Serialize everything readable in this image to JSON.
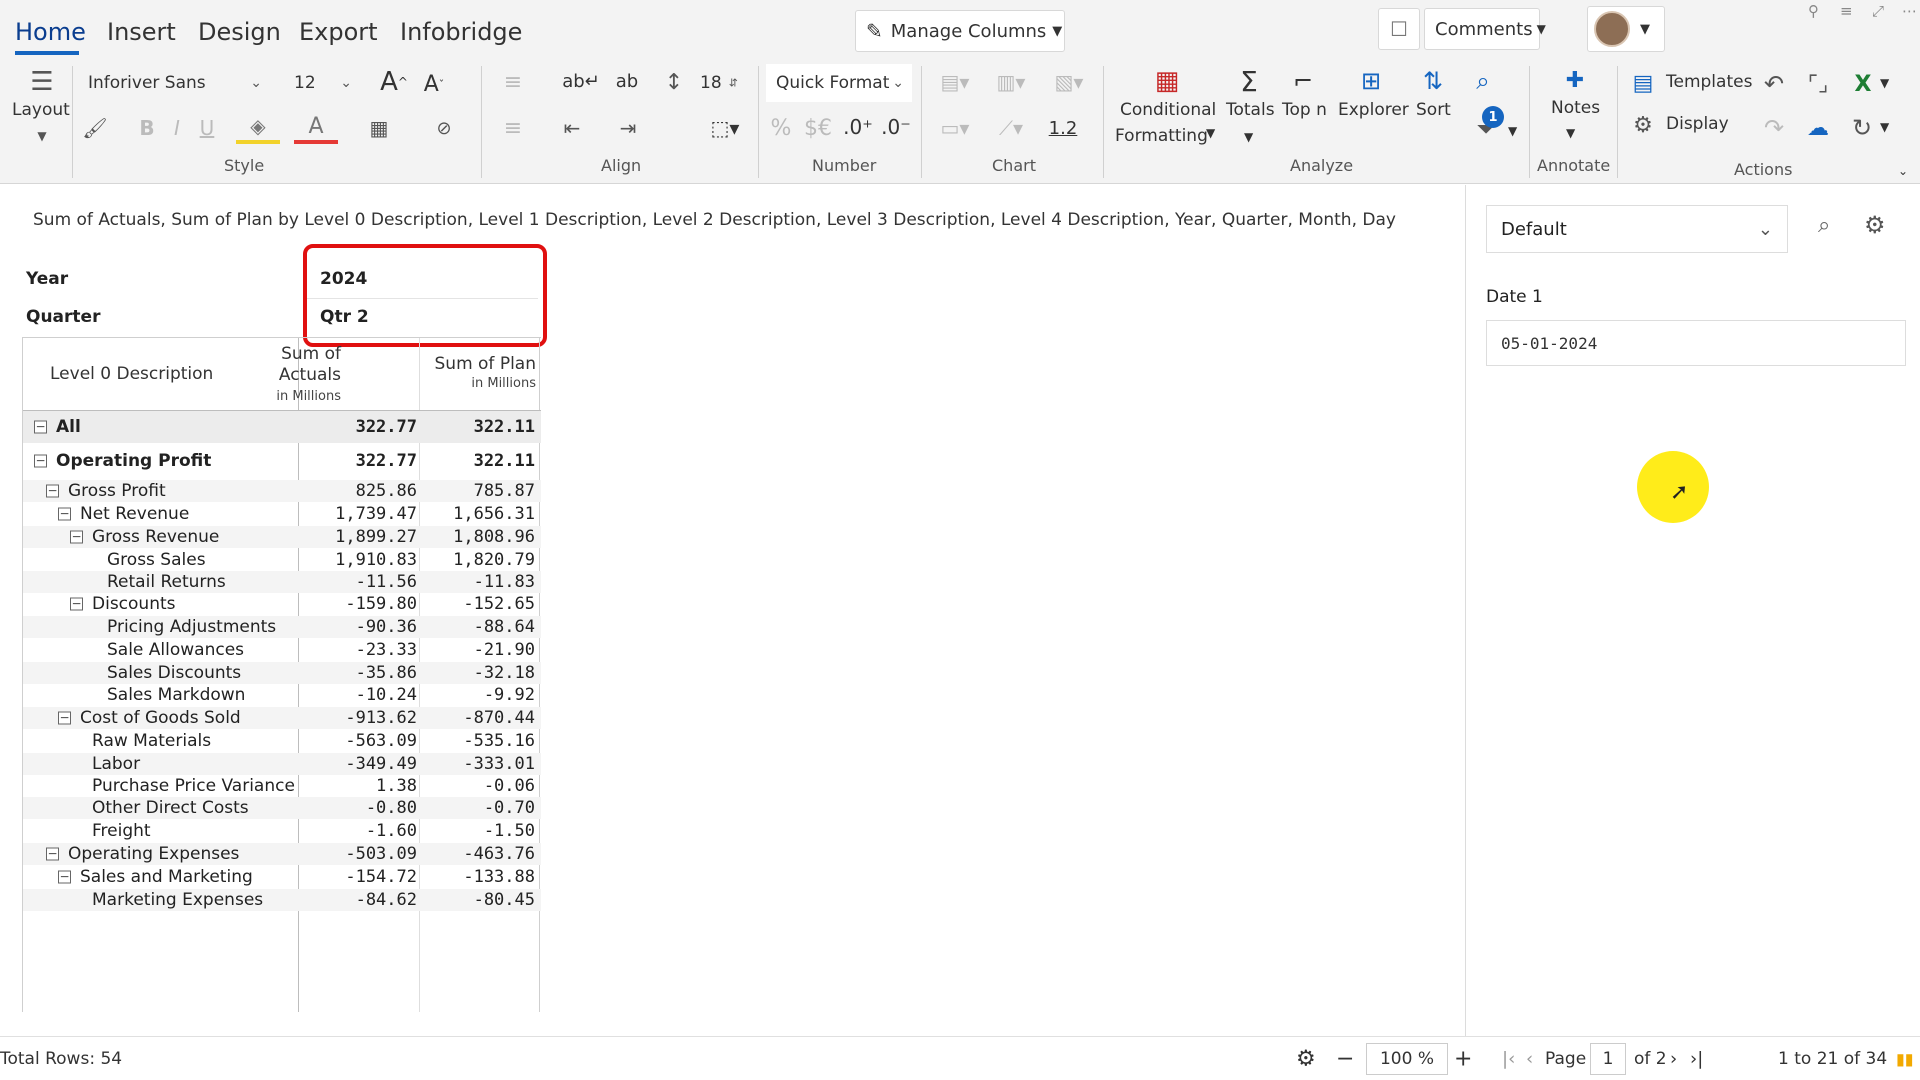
{
  "menu": {
    "tabs": [
      "Home",
      "Insert",
      "Design",
      "Export",
      "Infobridge"
    ]
  },
  "topbar": {
    "manage_columns": "Manage Columns",
    "comments": "Comments"
  },
  "ribbon": {
    "layout_label": "Layout",
    "font_family": "Inforiver Sans",
    "font_size": "12",
    "line_height": "18",
    "quick_format": "Quick Format",
    "decimal_value": "1.2",
    "conditional_line1": "Conditional",
    "conditional_line2": "Formatting",
    "totals": "Totals",
    "top_n": "Top n",
    "explorer": "Explorer",
    "sort": "Sort",
    "filter_badge": "1",
    "notes": "Notes",
    "templates": "Templates",
    "display": "Display",
    "groups": {
      "style": "Style",
      "align": "Align",
      "number": "Number",
      "chart": "Chart",
      "analyze": "Analyze",
      "annotate": "Annotate",
      "actions": "Actions"
    }
  },
  "report": {
    "title": "Sum of Actuals, Sum of Plan by Level 0 Description, Level 1 Description, Level 2 Description, Level 3 Description, Level 4 Description, Year, Quarter, Month, Day",
    "year_label": "Year",
    "year_value": "2024",
    "quarter_label": "Quarter",
    "quarter_value": "Qtr 2",
    "columns": {
      "label": "Level 0 Description",
      "actuals_line1": "Sum of",
      "actuals_line2": "Actuals",
      "plan": "Sum of Plan",
      "unit": "in Millions"
    },
    "rows": [
      {
        "label": "All",
        "actuals": "322.77",
        "plan": "322.11",
        "level": 0,
        "bold": true,
        "toggle": "⊟"
      },
      {
        "label": "Operating Profit",
        "actuals": "322.77",
        "plan": "322.11",
        "level": 0,
        "bold": true,
        "toggle": "⊟"
      },
      {
        "label": "Gross Profit",
        "actuals": "825.86",
        "plan": "785.87",
        "level": 1,
        "bold": false,
        "toggle": "⊟"
      },
      {
        "label": "Net Revenue",
        "actuals": "1,739.47",
        "plan": "1,656.31",
        "level": 2,
        "bold": false,
        "toggle": "⊟"
      },
      {
        "label": "Gross Revenue",
        "actuals": "1,899.27",
        "plan": "1,808.96",
        "level": 3,
        "bold": false,
        "toggle": "⊟"
      },
      {
        "label": "Gross Sales",
        "actuals": "1,910.83",
        "plan": "1,820.79",
        "level": 4,
        "bold": false,
        "toggle": ""
      },
      {
        "label": "Retail Returns",
        "actuals": "-11.56",
        "plan": "-11.83",
        "level": 4,
        "bold": false,
        "toggle": ""
      },
      {
        "label": "Discounts",
        "actuals": "-159.80",
        "plan": "-152.65",
        "level": 3,
        "bold": false,
        "toggle": "⊟"
      },
      {
        "label": "Pricing Adjustments",
        "actuals": "-90.36",
        "plan": "-88.64",
        "level": 4,
        "bold": false,
        "toggle": ""
      },
      {
        "label": "Sale Allowances",
        "actuals": "-23.33",
        "plan": "-21.90",
        "level": 4,
        "bold": false,
        "toggle": ""
      },
      {
        "label": "Sales Discounts",
        "actuals": "-35.86",
        "plan": "-32.18",
        "level": 4,
        "bold": false,
        "toggle": ""
      },
      {
        "label": "Sales Markdown",
        "actuals": "-10.24",
        "plan": "-9.92",
        "level": 4,
        "bold": false,
        "toggle": ""
      },
      {
        "label": "Cost of Goods Sold",
        "actuals": "-913.62",
        "plan": "-870.44",
        "level": 2,
        "bold": false,
        "toggle": "⊟"
      },
      {
        "label": "Raw Materials",
        "actuals": "-563.09",
        "plan": "-535.16",
        "level": 3,
        "bold": false,
        "toggle": ""
      },
      {
        "label": "Labor",
        "actuals": "-349.49",
        "plan": "-333.01",
        "level": 3,
        "bold": false,
        "toggle": ""
      },
      {
        "label": "Purchase Price Variance",
        "actuals": "1.38",
        "plan": "-0.06",
        "level": 3,
        "bold": false,
        "toggle": ""
      },
      {
        "label": "Other Direct Costs",
        "actuals": "-0.80",
        "plan": "-0.70",
        "level": 3,
        "bold": false,
        "toggle": ""
      },
      {
        "label": "Freight",
        "actuals": "-1.60",
        "plan": "-1.50",
        "level": 3,
        "bold": false,
        "toggle": ""
      },
      {
        "label": "Operating Expenses",
        "actuals": "-503.09",
        "plan": "-463.76",
        "level": 1,
        "bold": false,
        "toggle": "⊟"
      },
      {
        "label": "Sales and Marketing",
        "actuals": "-154.72",
        "plan": "-133.88",
        "level": 2,
        "bold": false,
        "toggle": "⊟"
      },
      {
        "label": "Marketing Expenses",
        "actuals": "-84.62",
        "plan": "-80.45",
        "level": 3,
        "bold": false,
        "toggle": ""
      }
    ]
  },
  "panel": {
    "view": "Default",
    "date_label": "Date 1",
    "date_value": "05-01-2024"
  },
  "status": {
    "total_rows": "Total Rows: 54",
    "zoom": "100 %",
    "page_label": "Page",
    "page_value": "1",
    "page_of": "of 2",
    "range": "1 to 21 of 34"
  },
  "colors": {
    "accent": "#1565c0",
    "highlight_box": "#e01010",
    "cursor_highlight": "#ffec1a"
  }
}
